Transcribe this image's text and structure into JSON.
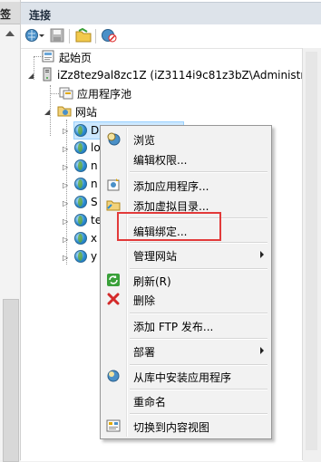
{
  "left_strip": {
    "header_fragment": "签"
  },
  "panel": {
    "title": "连接"
  },
  "toolbar": {
    "icons": [
      "back-globe-icon",
      "save-icon",
      "folder-icon",
      "disconnect-icon"
    ]
  },
  "tree": {
    "start_page": "起始页",
    "server": "iZz8tez9al8zc1Z (iZ3114i9c81z3bZ\\Administrat",
    "app_pools": "应用程序池",
    "sites": "网站",
    "site_items": [
      "D",
      "lo",
      "n",
      "n",
      "S",
      "te",
      "x",
      "y"
    ]
  },
  "menu": {
    "items": [
      {
        "label": "浏览",
        "icon": "browse-icon"
      },
      {
        "label": "编辑权限...",
        "icon": ""
      },
      {
        "label": "添加应用程序...",
        "icon": "add-app-icon"
      },
      {
        "label": "添加虚拟目录...",
        "icon": "add-vdir-icon"
      },
      {
        "label": "编辑绑定...",
        "icon": ""
      },
      {
        "label": "管理网站",
        "icon": ""
      },
      {
        "label": "刷新(R)",
        "icon": "refresh-icon"
      },
      {
        "label": "删除",
        "icon": "delete-icon"
      },
      {
        "label": "添加 FTP 发布...",
        "icon": ""
      },
      {
        "label": "部署",
        "icon": ""
      },
      {
        "label": "从库中安装应用程序",
        "icon": "install-icon"
      },
      {
        "label": "重命名",
        "icon": ""
      },
      {
        "label": "切换到内容视图",
        "icon": "content-view-icon"
      }
    ],
    "highlight_color": "#e23a3a"
  }
}
